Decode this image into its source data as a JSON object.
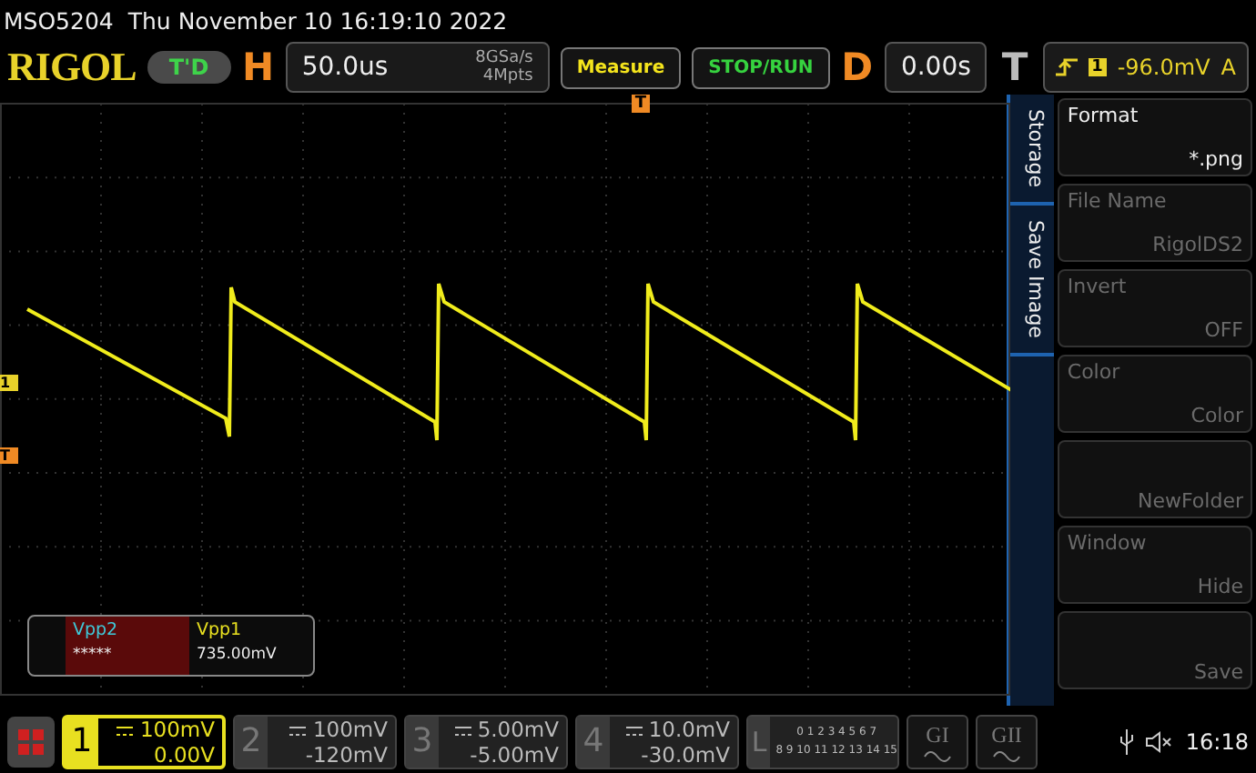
{
  "header": {
    "model": "MSO5204",
    "datetime": "Thu November 10 16:19:10 2022"
  },
  "toolbar": {
    "logo": "RIGOL",
    "mode_badge": "T'D",
    "horizontal": {
      "letter": "H",
      "timebase": "50.0us",
      "sample_rate": "8GSa/s",
      "memory_depth": "4Mpts"
    },
    "buttons": [
      "Measure",
      "STOP/RUN"
    ],
    "delay": {
      "letter": "D",
      "value": "0.00s"
    },
    "trigger": {
      "letter": "T",
      "source": "1",
      "level": "-96.0mV",
      "mode": "A"
    }
  },
  "markers": {
    "trigger_position": "T",
    "channel": "1",
    "trigger_level": "T"
  },
  "measurements": [
    {
      "label": "Vpp2",
      "value": "*****",
      "color": "#3fc8d8"
    },
    {
      "label": "Vpp1",
      "value": "735.00mV",
      "color": "#e8e020"
    }
  ],
  "side_tabs": [
    "Storage",
    "Save Image"
  ],
  "menu": [
    {
      "label": "Format",
      "value": "*.png",
      "disabled": false
    },
    {
      "label": "File Name",
      "value": "RigolDS2",
      "disabled": true
    },
    {
      "label": "Invert",
      "value": "OFF",
      "disabled": true
    },
    {
      "label": "Color",
      "value": "Color",
      "disabled": true
    },
    {
      "value": "NewFolder",
      "disabled": true
    },
    {
      "label": "Window",
      "value": "Hide",
      "disabled": true
    },
    {
      "value": "Save",
      "disabled": true
    }
  ],
  "channels": [
    {
      "number": "1",
      "scale": "100mV",
      "offset": "0.00V",
      "selected": true
    },
    {
      "number": "2",
      "scale": "100mV",
      "offset": "-120mV",
      "selected": false
    },
    {
      "number": "3",
      "scale": "5.00mV",
      "offset": "-5.00mV",
      "selected": false
    },
    {
      "number": "4",
      "scale": "10.0mV",
      "offset": "-30.0mV",
      "selected": false
    }
  ],
  "logic": {
    "letter": "L",
    "row_1": "0 1 2 3  4 5 6 7",
    "row_2": "8 9 10 11 12 13 14 15"
  },
  "generators": [
    "GI",
    "GII"
  ],
  "status": {
    "time": "16:18"
  }
}
